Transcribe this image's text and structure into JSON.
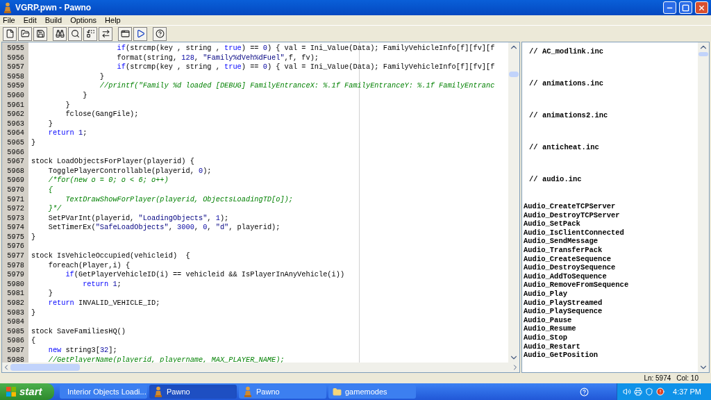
{
  "window": {
    "title": "VGRP.pwn - Pawno"
  },
  "menu": [
    "File",
    "Edit",
    "Build",
    "Options",
    "Help"
  ],
  "editor": {
    "lines": [
      {
        "number": "5955",
        "tokens": [
          {
            "kind": "keyword",
            "text": "                    if"
          },
          {
            "kind": "plain",
            "text": "(strcmp(key , string , "
          },
          {
            "kind": "keyword",
            "text": "true"
          },
          {
            "kind": "plain",
            "text": ") == "
          },
          {
            "kind": "number",
            "text": "0"
          },
          {
            "kind": "plain",
            "text": ") { val = Ini_Value(Data); FamilyVehicleInfo[f][fv][f"
          }
        ]
      },
      {
        "number": "5956",
        "tokens": [
          {
            "kind": "plain",
            "text": "                    format(string, "
          },
          {
            "kind": "number",
            "text": "128"
          },
          {
            "kind": "plain",
            "text": ", "
          },
          {
            "kind": "string",
            "text": "\"Family%dVeh%dFuel\""
          },
          {
            "kind": "plain",
            "text": ",f, fv);"
          }
        ]
      },
      {
        "number": "5957",
        "tokens": [
          {
            "kind": "keyword",
            "text": "                    if"
          },
          {
            "kind": "plain",
            "text": "(strcmp(key , string , "
          },
          {
            "kind": "keyword",
            "text": "true"
          },
          {
            "kind": "plain",
            "text": ") == "
          },
          {
            "kind": "number",
            "text": "0"
          },
          {
            "kind": "plain",
            "text": ") { val = Ini_Value(Data); FamilyVehicleInfo[f][fv][f"
          }
        ]
      },
      {
        "number": "5958",
        "tokens": [
          {
            "kind": "plain",
            "text": "                }"
          }
        ]
      },
      {
        "number": "5959",
        "tokens": [
          {
            "kind": "comment",
            "text": "                //printf(\"Family %d loaded [DEBUG] FamilyEntranceX: %.1f FamilyEntranceY: %.1f FamilyEntranc"
          }
        ]
      },
      {
        "number": "5960",
        "tokens": [
          {
            "kind": "plain",
            "text": "            }"
          }
        ]
      },
      {
        "number": "5961",
        "tokens": [
          {
            "kind": "plain",
            "text": "        }"
          }
        ]
      },
      {
        "number": "5962",
        "tokens": [
          {
            "kind": "plain",
            "text": "        fclose(GangFile);"
          }
        ]
      },
      {
        "number": "5963",
        "tokens": [
          {
            "kind": "plain",
            "text": "    }"
          }
        ]
      },
      {
        "number": "5964",
        "tokens": [
          {
            "kind": "keyword",
            "text": "    return"
          },
          {
            "kind": "number",
            "text": " 1"
          },
          {
            "kind": "plain",
            "text": ";"
          }
        ]
      },
      {
        "number": "5965",
        "tokens": [
          {
            "kind": "plain",
            "text": "}"
          }
        ]
      },
      {
        "number": "5966"
      },
      {
        "number": "5967",
        "tokens": [
          {
            "kind": "plain",
            "text": "stock LoadObjectsForPlayer(playerid) {"
          }
        ]
      },
      {
        "number": "5968",
        "tokens": [
          {
            "kind": "plain",
            "text": "    TogglePlayerControllable(playerid, "
          },
          {
            "kind": "number",
            "text": "0"
          },
          {
            "kind": "plain",
            "text": ");"
          }
        ]
      },
      {
        "number": "5969",
        "tokens": [
          {
            "kind": "comment",
            "text": "    /*for(new o = 0; o < 6; o++)"
          }
        ]
      },
      {
        "number": "5970",
        "tokens": [
          {
            "kind": "comment",
            "text": "    {"
          }
        ]
      },
      {
        "number": "5971",
        "tokens": [
          {
            "kind": "comment",
            "text": "        TextDrawShowForPlayer(playerid, ObjectsLoadingTD[o]);"
          }
        ]
      },
      {
        "number": "5972",
        "tokens": [
          {
            "kind": "comment",
            "text": "    }*/"
          }
        ]
      },
      {
        "number": "5973",
        "tokens": [
          {
            "kind": "plain",
            "text": "    SetPVarInt(playerid, "
          },
          {
            "kind": "string",
            "text": "\"LoadingObjects\""
          },
          {
            "kind": "plain",
            "text": ", "
          },
          {
            "kind": "number",
            "text": "1"
          },
          {
            "kind": "plain",
            "text": ");"
          }
        ]
      },
      {
        "number": "5974",
        "tokens": [
          {
            "kind": "plain",
            "text": "    SetTimerEx("
          },
          {
            "kind": "string",
            "text": "\"SafeLoadObjects\""
          },
          {
            "kind": "plain",
            "text": ", "
          },
          {
            "kind": "number",
            "text": "3000"
          },
          {
            "kind": "plain",
            "text": ", "
          },
          {
            "kind": "number",
            "text": "0"
          },
          {
            "kind": "plain",
            "text": ", "
          },
          {
            "kind": "string",
            "text": "\"d\""
          },
          {
            "kind": "plain",
            "text": ", playerid);"
          }
        ]
      },
      {
        "number": "5975",
        "tokens": [
          {
            "kind": "plain",
            "text": "}"
          }
        ]
      },
      {
        "number": "5976"
      },
      {
        "number": "5977",
        "tokens": [
          {
            "kind": "plain",
            "text": "stock IsVehicleOccupied(vehicleid)  {"
          }
        ]
      },
      {
        "number": "5978",
        "tokens": [
          {
            "kind": "plain",
            "text": "    foreach(Player,i) {"
          }
        ]
      },
      {
        "number": "5979",
        "tokens": [
          {
            "kind": "keyword",
            "text": "        if"
          },
          {
            "kind": "plain",
            "text": "(GetPlayerVehicleID(i) == vehicleid && IsPlayerInAnyVehicle(i))"
          }
        ]
      },
      {
        "number": "5980",
        "tokens": [
          {
            "kind": "keyword",
            "text": "            return"
          },
          {
            "kind": "number",
            "text": " 1"
          },
          {
            "kind": "plain",
            "text": ";"
          }
        ]
      },
      {
        "number": "5981",
        "tokens": [
          {
            "kind": "plain",
            "text": "    }"
          }
        ]
      },
      {
        "number": "5982",
        "tokens": [
          {
            "kind": "keyword",
            "text": "    return"
          },
          {
            "kind": "plain",
            "text": " INVALID_VEHICLE_ID;"
          }
        ]
      },
      {
        "number": "5983",
        "tokens": [
          {
            "kind": "plain",
            "text": "}"
          }
        ]
      },
      {
        "number": "5984"
      },
      {
        "number": "5985",
        "tokens": [
          {
            "kind": "plain",
            "text": "stock SaveFamiliesHQ()"
          }
        ]
      },
      {
        "number": "5986",
        "tokens": [
          {
            "kind": "plain",
            "text": "{"
          }
        ]
      },
      {
        "number": "5987",
        "tokens": [
          {
            "kind": "keyword",
            "text": "    new"
          },
          {
            "kind": "plain",
            "text": " string3["
          },
          {
            "kind": "number",
            "text": "32"
          },
          {
            "kind": "plain",
            "text": "];"
          }
        ]
      },
      {
        "number": "5988",
        "tokens": [
          {
            "kind": "comment",
            "text": "    //GetPlayerName(playerid, playername, MAX_PLAYER_NAME);"
          }
        ]
      }
    ]
  },
  "functions": [
    {
      "kind": "header",
      "text": "// AC_modlink.inc"
    },
    {
      "kind": "header",
      "text": "// animations.inc"
    },
    {
      "kind": "header",
      "text": "// animations2.inc"
    },
    {
      "kind": "header",
      "text": "// anticheat.inc"
    },
    {
      "kind": "header",
      "text": "// audio.inc"
    },
    {
      "kind": "function",
      "text": "Audio_CreateTCPServer"
    },
    {
      "kind": "function",
      "text": "Audio_DestroyTCPServer"
    },
    {
      "kind": "function",
      "text": "Audio_SetPack"
    },
    {
      "kind": "function",
      "text": "Audio_IsClientConnected"
    },
    {
      "kind": "function",
      "text": "Audio_SendMessage"
    },
    {
      "kind": "function",
      "text": "Audio_TransferPack"
    },
    {
      "kind": "function",
      "text": "Audio_CreateSequence"
    },
    {
      "kind": "function",
      "text": "Audio_DestroySequence"
    },
    {
      "kind": "function",
      "text": "Audio_AddToSequence"
    },
    {
      "kind": "function",
      "text": "Audio_RemoveFromSequence"
    },
    {
      "kind": "function",
      "text": "Audio_Play"
    },
    {
      "kind": "function",
      "text": "Audio_PlayStreamed"
    },
    {
      "kind": "function",
      "text": "Audio_PlaySequence"
    },
    {
      "kind": "function",
      "text": "Audio_Pause"
    },
    {
      "kind": "function",
      "text": "Audio_Resume"
    },
    {
      "kind": "function",
      "text": "Audio_Stop"
    },
    {
      "kind": "function",
      "text": "Audio_Restart"
    },
    {
      "kind": "function",
      "text": "Audio_GetPosition"
    }
  ],
  "status_bar": {
    "position": "Ln: 5974",
    "column": "Col: 10"
  },
  "taskbar": {
    "start": "start",
    "tasks": [
      {
        "label": "Interior Objects Loadi...",
        "kind": "browser",
        "selected": false
      },
      {
        "label": "Pawno",
        "kind": "pawno",
        "selected": true
      },
      {
        "label": "Pawno",
        "kind": "pawno",
        "selected": false
      },
      {
        "label": "gamemodes",
        "kind": "folder",
        "selected": false
      }
    ],
    "clock": "4:37 PM"
  }
}
